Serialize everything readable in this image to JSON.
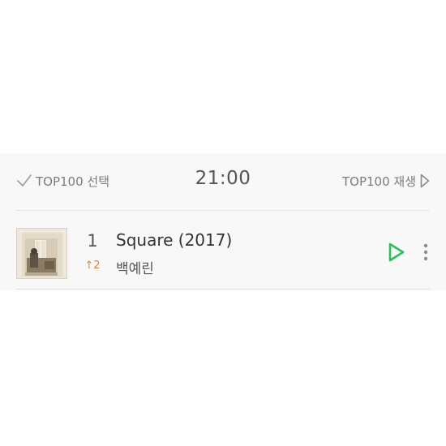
{
  "header": {
    "select_all_label": "TOP100 선택",
    "time": "21:00",
    "play_all_label": "TOP100 재생"
  },
  "chart": [
    {
      "rank": "1",
      "rank_change": "↑2",
      "title": "Square (2017)",
      "artist": "백예린"
    }
  ],
  "icons": {
    "select": "check-icon",
    "play_all": "play-outline-icon",
    "play": "play-icon",
    "more": "more-vertical-icon"
  },
  "colors": {
    "play_accent": "#27c05b",
    "rank_up": "#e6862a",
    "panel_bg": "#f8f8f8"
  }
}
